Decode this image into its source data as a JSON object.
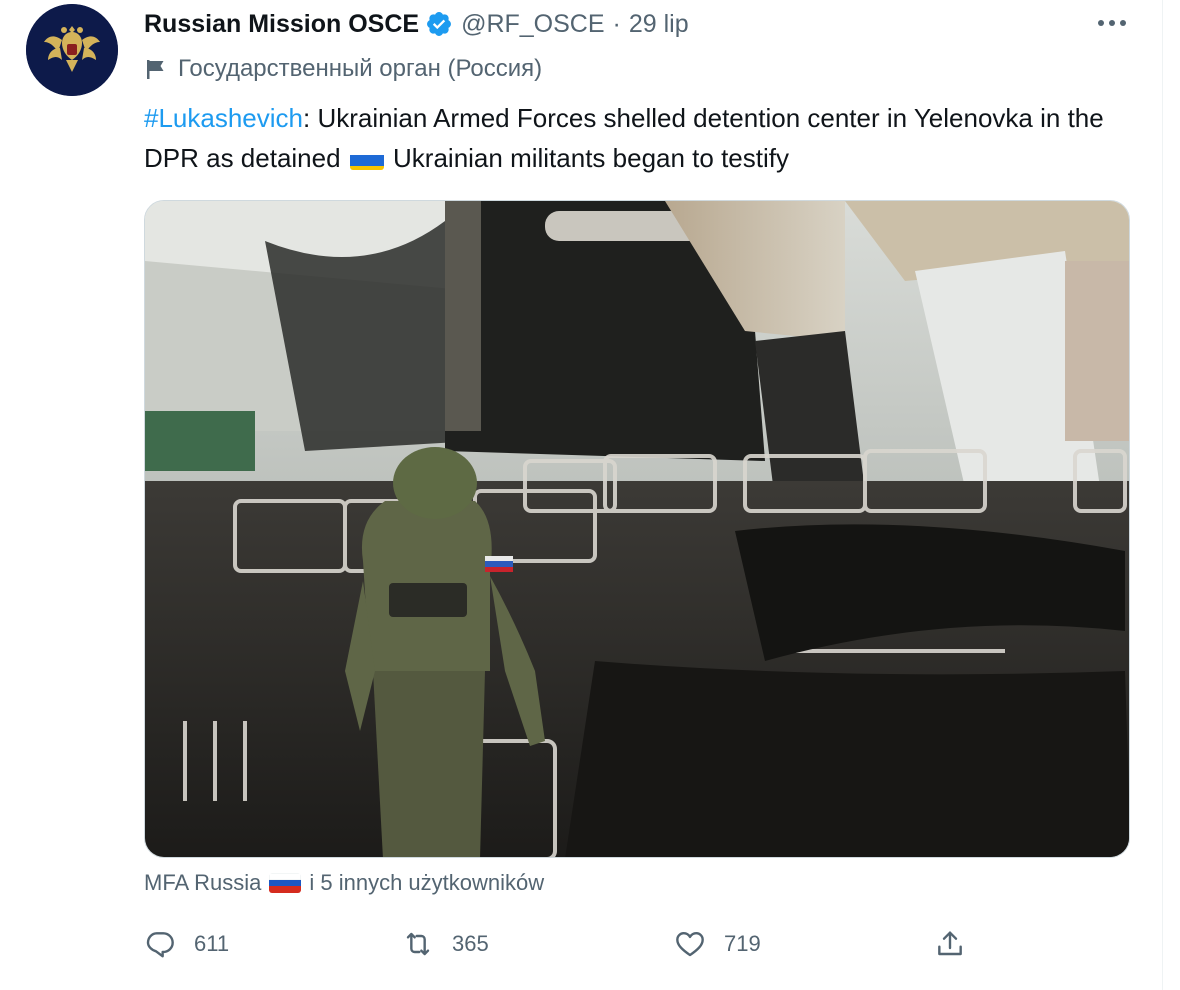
{
  "tweet": {
    "author_name": "Russian Mission OSCE",
    "handle": "@RF_OSCE",
    "separator": "·",
    "date": "29 lip",
    "label": "Государственный орган (Россия)",
    "hashtag": "#Lukashevich",
    "text_part1": ": Ukrainian Armed Forces shelled detention center in Yelenovka in the DPR as detained",
    "text_part2": " Ukrainian militants began to testify",
    "tagged_user": "MFA Russia",
    "tagged_rest": "i 5 innych użytkowników"
  },
  "stats": {
    "replies": "611",
    "retweets": "365",
    "likes": "719"
  },
  "icons": {
    "verified": "verified-badge-icon",
    "more": "more-icon",
    "label": "flag-icon",
    "reply": "reply-icon",
    "retweet": "retweet-icon",
    "like": "like-icon",
    "share": "share-icon"
  },
  "colors": {
    "accent": "#1d9bf0",
    "secondary_text": "#536471",
    "avatar_bg": "#0d1a4a"
  }
}
